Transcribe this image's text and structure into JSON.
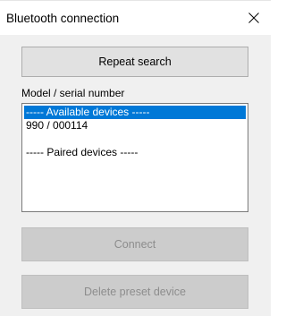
{
  "window": {
    "title": "Bluetooth connection",
    "close_symbol": "✕"
  },
  "buttons": {
    "repeat_search": "Repeat search",
    "connect": "Connect",
    "delete_preset": "Delete preset device"
  },
  "list": {
    "label": "Model / serial number",
    "items": [
      {
        "text": "----- Available devices -----",
        "selected": true
      },
      {
        "text": "990 / 000114",
        "selected": false
      },
      {
        "text": "",
        "selected": false
      },
      {
        "text": "----- Paired devices -----",
        "selected": false
      }
    ]
  },
  "colors": {
    "selection": "#0078d7",
    "dialog_background": "#f0f0f0",
    "disabled_text": "#8d8d8d"
  }
}
